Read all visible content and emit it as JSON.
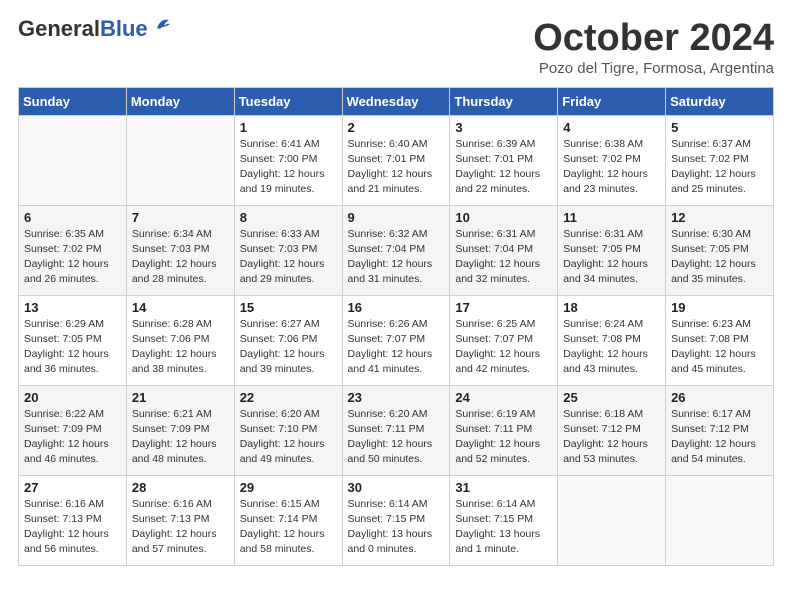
{
  "header": {
    "logo_general": "General",
    "logo_blue": "Blue",
    "month_title": "October 2024",
    "location": "Pozo del Tigre, Formosa, Argentina"
  },
  "days_of_week": [
    "Sunday",
    "Monday",
    "Tuesday",
    "Wednesday",
    "Thursday",
    "Friday",
    "Saturday"
  ],
  "weeks": [
    [
      {
        "day": "",
        "info": ""
      },
      {
        "day": "",
        "info": ""
      },
      {
        "day": "1",
        "info": "Sunrise: 6:41 AM\nSunset: 7:00 PM\nDaylight: 12 hours\nand 19 minutes."
      },
      {
        "day": "2",
        "info": "Sunrise: 6:40 AM\nSunset: 7:01 PM\nDaylight: 12 hours\nand 21 minutes."
      },
      {
        "day": "3",
        "info": "Sunrise: 6:39 AM\nSunset: 7:01 PM\nDaylight: 12 hours\nand 22 minutes."
      },
      {
        "day": "4",
        "info": "Sunrise: 6:38 AM\nSunset: 7:02 PM\nDaylight: 12 hours\nand 23 minutes."
      },
      {
        "day": "5",
        "info": "Sunrise: 6:37 AM\nSunset: 7:02 PM\nDaylight: 12 hours\nand 25 minutes."
      }
    ],
    [
      {
        "day": "6",
        "info": "Sunrise: 6:35 AM\nSunset: 7:02 PM\nDaylight: 12 hours\nand 26 minutes."
      },
      {
        "day": "7",
        "info": "Sunrise: 6:34 AM\nSunset: 7:03 PM\nDaylight: 12 hours\nand 28 minutes."
      },
      {
        "day": "8",
        "info": "Sunrise: 6:33 AM\nSunset: 7:03 PM\nDaylight: 12 hours\nand 29 minutes."
      },
      {
        "day": "9",
        "info": "Sunrise: 6:32 AM\nSunset: 7:04 PM\nDaylight: 12 hours\nand 31 minutes."
      },
      {
        "day": "10",
        "info": "Sunrise: 6:31 AM\nSunset: 7:04 PM\nDaylight: 12 hours\nand 32 minutes."
      },
      {
        "day": "11",
        "info": "Sunrise: 6:31 AM\nSunset: 7:05 PM\nDaylight: 12 hours\nand 34 minutes."
      },
      {
        "day": "12",
        "info": "Sunrise: 6:30 AM\nSunset: 7:05 PM\nDaylight: 12 hours\nand 35 minutes."
      }
    ],
    [
      {
        "day": "13",
        "info": "Sunrise: 6:29 AM\nSunset: 7:05 PM\nDaylight: 12 hours\nand 36 minutes."
      },
      {
        "day": "14",
        "info": "Sunrise: 6:28 AM\nSunset: 7:06 PM\nDaylight: 12 hours\nand 38 minutes."
      },
      {
        "day": "15",
        "info": "Sunrise: 6:27 AM\nSunset: 7:06 PM\nDaylight: 12 hours\nand 39 minutes."
      },
      {
        "day": "16",
        "info": "Sunrise: 6:26 AM\nSunset: 7:07 PM\nDaylight: 12 hours\nand 41 minutes."
      },
      {
        "day": "17",
        "info": "Sunrise: 6:25 AM\nSunset: 7:07 PM\nDaylight: 12 hours\nand 42 minutes."
      },
      {
        "day": "18",
        "info": "Sunrise: 6:24 AM\nSunset: 7:08 PM\nDaylight: 12 hours\nand 43 minutes."
      },
      {
        "day": "19",
        "info": "Sunrise: 6:23 AM\nSunset: 7:08 PM\nDaylight: 12 hours\nand 45 minutes."
      }
    ],
    [
      {
        "day": "20",
        "info": "Sunrise: 6:22 AM\nSunset: 7:09 PM\nDaylight: 12 hours\nand 46 minutes."
      },
      {
        "day": "21",
        "info": "Sunrise: 6:21 AM\nSunset: 7:09 PM\nDaylight: 12 hours\nand 48 minutes."
      },
      {
        "day": "22",
        "info": "Sunrise: 6:20 AM\nSunset: 7:10 PM\nDaylight: 12 hours\nand 49 minutes."
      },
      {
        "day": "23",
        "info": "Sunrise: 6:20 AM\nSunset: 7:11 PM\nDaylight: 12 hours\nand 50 minutes."
      },
      {
        "day": "24",
        "info": "Sunrise: 6:19 AM\nSunset: 7:11 PM\nDaylight: 12 hours\nand 52 minutes."
      },
      {
        "day": "25",
        "info": "Sunrise: 6:18 AM\nSunset: 7:12 PM\nDaylight: 12 hours\nand 53 minutes."
      },
      {
        "day": "26",
        "info": "Sunrise: 6:17 AM\nSunset: 7:12 PM\nDaylight: 12 hours\nand 54 minutes."
      }
    ],
    [
      {
        "day": "27",
        "info": "Sunrise: 6:16 AM\nSunset: 7:13 PM\nDaylight: 12 hours\nand 56 minutes."
      },
      {
        "day": "28",
        "info": "Sunrise: 6:16 AM\nSunset: 7:13 PM\nDaylight: 12 hours\nand 57 minutes."
      },
      {
        "day": "29",
        "info": "Sunrise: 6:15 AM\nSunset: 7:14 PM\nDaylight: 12 hours\nand 58 minutes."
      },
      {
        "day": "30",
        "info": "Sunrise: 6:14 AM\nSunset: 7:15 PM\nDaylight: 13 hours\nand 0 minutes."
      },
      {
        "day": "31",
        "info": "Sunrise: 6:14 AM\nSunset: 7:15 PM\nDaylight: 13 hours\nand 1 minute."
      },
      {
        "day": "",
        "info": ""
      },
      {
        "day": "",
        "info": ""
      }
    ]
  ]
}
